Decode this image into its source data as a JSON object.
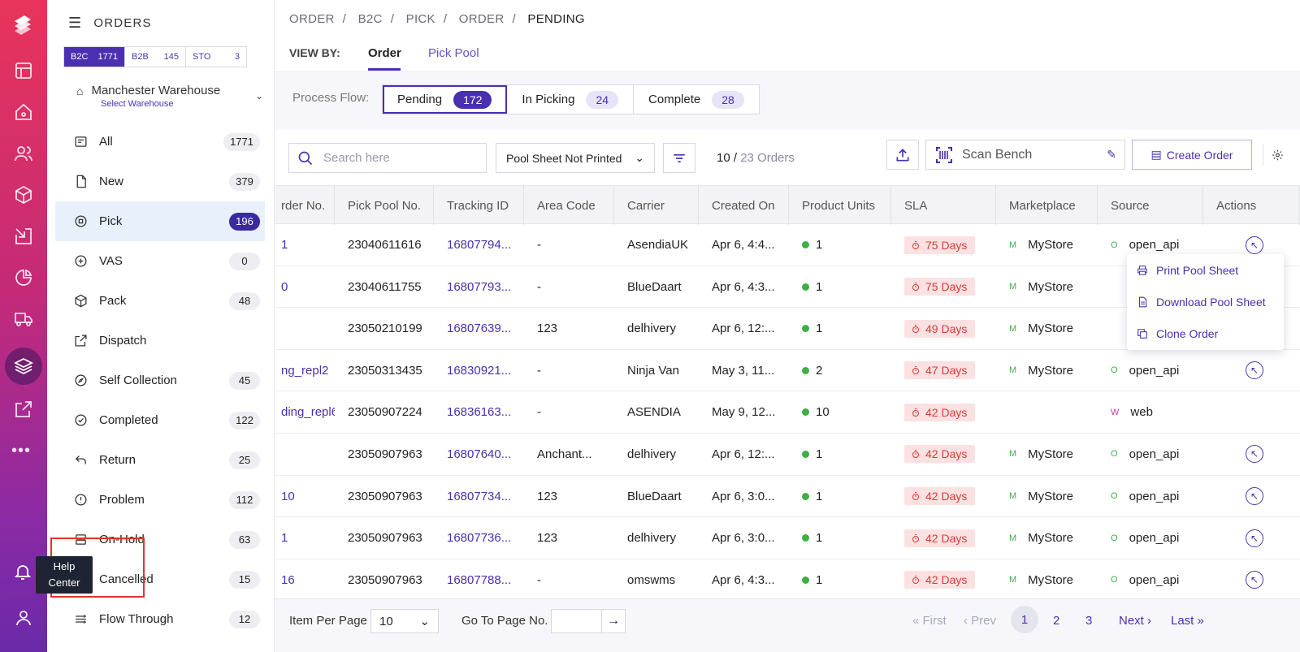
{
  "rail": {
    "help_tip_line1": "Help",
    "help_tip_line2": "Center"
  },
  "panel": {
    "title": "ORDERS",
    "segments": [
      {
        "label": "B2C",
        "count": "1771"
      },
      {
        "label": "B2B",
        "count": "145"
      },
      {
        "label": "STO",
        "count": "3"
      }
    ],
    "warehouse": {
      "name": "Manchester Warehouse",
      "select": "Select Warehouse"
    },
    "nav": [
      {
        "label": "All",
        "count": "1771",
        "icon": "inbox-icon"
      },
      {
        "label": "New",
        "count": "379",
        "icon": "file-icon"
      },
      {
        "label": "Pick",
        "count": "196",
        "icon": "pick-icon"
      },
      {
        "label": "VAS",
        "count": "0",
        "icon": "plus-circle-icon"
      },
      {
        "label": "Pack",
        "count": "48",
        "icon": "box-icon"
      },
      {
        "label": "Dispatch",
        "count": "",
        "icon": "external-link-icon"
      },
      {
        "label": "Self Collection",
        "count": "45",
        "icon": "compass-icon"
      },
      {
        "label": "Completed",
        "count": "122",
        "icon": "check-circle-icon"
      },
      {
        "label": "Return",
        "count": "25",
        "icon": "return-icon"
      },
      {
        "label": "Problem",
        "count": "112",
        "icon": "alert-icon"
      },
      {
        "label": "On-Hold",
        "count": "63",
        "icon": "hold-icon"
      },
      {
        "label": "Cancelled",
        "count": "15",
        "icon": "cancel-icon"
      },
      {
        "label": "Flow Through",
        "count": "12",
        "icon": "flow-icon"
      }
    ]
  },
  "breadcrumb": [
    "ORDER",
    "B2C",
    "PICK",
    "ORDER",
    "PENDING"
  ],
  "viewby": {
    "label": "VIEW BY:",
    "tabs": [
      "Order",
      "Pick Pool"
    ]
  },
  "flow": {
    "label": "Process Flow:",
    "items": [
      {
        "label": "Pending",
        "count": "172"
      },
      {
        "label": "In Picking",
        "count": "24"
      },
      {
        "label": "Complete",
        "count": "28"
      }
    ]
  },
  "toolbar": {
    "search_placeholder": "Search here",
    "filter_select": "Pool Sheet Not Printed",
    "count_shown": "10",
    "count_total": "23 Orders",
    "scan_bench": "Scan Bench",
    "create_order": "Create Order"
  },
  "table": {
    "headers": [
      "rder No.",
      "Pick Pool No.",
      "Tracking ID",
      "Area Code",
      "Carrier",
      "Created On",
      "Product Units",
      "SLA",
      "Marketplace",
      "Source",
      "Actions"
    ],
    "rows": [
      {
        "order": "1",
        "pool": "23040611616",
        "track": "16807794...",
        "area": "-",
        "carrier": "AsendiaUK",
        "created": "Apr 6, 4:4...",
        "units": "1",
        "sla": "75 Days",
        "mk": "M",
        "market": "MyStore",
        "srcIcon": "O",
        "source": "open_api"
      },
      {
        "order": "0",
        "pool": "23040611755",
        "track": "16807793...",
        "area": "-",
        "carrier": "BlueDaart",
        "created": "Apr 6, 4:3...",
        "units": "1",
        "sla": "75 Days",
        "mk": "M",
        "market": "MyStore",
        "srcIcon": "",
        "source": ""
      },
      {
        "order": "",
        "pool": "23050210199",
        "track": "16807639...",
        "area": "123",
        "carrier": "delhivery",
        "created": "Apr 6, 12:...",
        "units": "1",
        "sla": "49 Days",
        "mk": "M",
        "market": "MyStore",
        "srcIcon": "",
        "source": ""
      },
      {
        "order": "ng_repl2",
        "pool": "23050313435",
        "track": "16830921...",
        "area": "-",
        "carrier": "Ninja Van",
        "created": "May 3, 11...",
        "units": "2",
        "sla": "47 Days",
        "mk": "M",
        "market": "MyStore",
        "srcIcon": "O",
        "source": "open_api"
      },
      {
        "order": "ding_repl6",
        "pool": "23050907224",
        "track": "16836163...",
        "area": "-",
        "carrier": "ASENDIA",
        "created": "May 9, 12...",
        "units": "10",
        "sla": "42 Days",
        "mk": "",
        "market": "",
        "srcIcon": "W",
        "source": "web"
      },
      {
        "order": "",
        "pool": "23050907963",
        "track": "16807640...",
        "area": "Anchant...",
        "carrier": "delhivery",
        "created": "Apr 6, 12:...",
        "units": "1",
        "sla": "42 Days",
        "mk": "M",
        "market": "MyStore",
        "srcIcon": "O",
        "source": "open_api"
      },
      {
        "order": "10",
        "pool": "23050907963",
        "track": "16807734...",
        "area": "123",
        "carrier": "BlueDaart",
        "created": "Apr 6, 3:0...",
        "units": "1",
        "sla": "42 Days",
        "mk": "M",
        "market": "MyStore",
        "srcIcon": "O",
        "source": "open_api"
      },
      {
        "order": "1",
        "pool": "23050907963",
        "track": "16807736...",
        "area": "123",
        "carrier": "delhivery",
        "created": "Apr 6, 3:0...",
        "units": "1",
        "sla": "42 Days",
        "mk": "M",
        "market": "MyStore",
        "srcIcon": "O",
        "source": "open_api"
      },
      {
        "order": "16",
        "pool": "23050907963",
        "track": "16807788...",
        "area": "-",
        "carrier": "omswms",
        "created": "Apr 6, 4:3...",
        "units": "1",
        "sla": "42 Days",
        "mk": "M",
        "market": "MyStore",
        "srcIcon": "O",
        "source": "open_api"
      }
    ]
  },
  "menu": [
    "Print Pool Sheet",
    "Download Pool Sheet",
    "Clone Order"
  ],
  "footer": {
    "item_per_page": "Item Per Page",
    "ipp_value": "10",
    "go_to": "Go To Page No.",
    "first": "First",
    "prev": "Prev",
    "pages": [
      "1",
      "2",
      "3"
    ],
    "next": "Next",
    "last": "Last"
  }
}
